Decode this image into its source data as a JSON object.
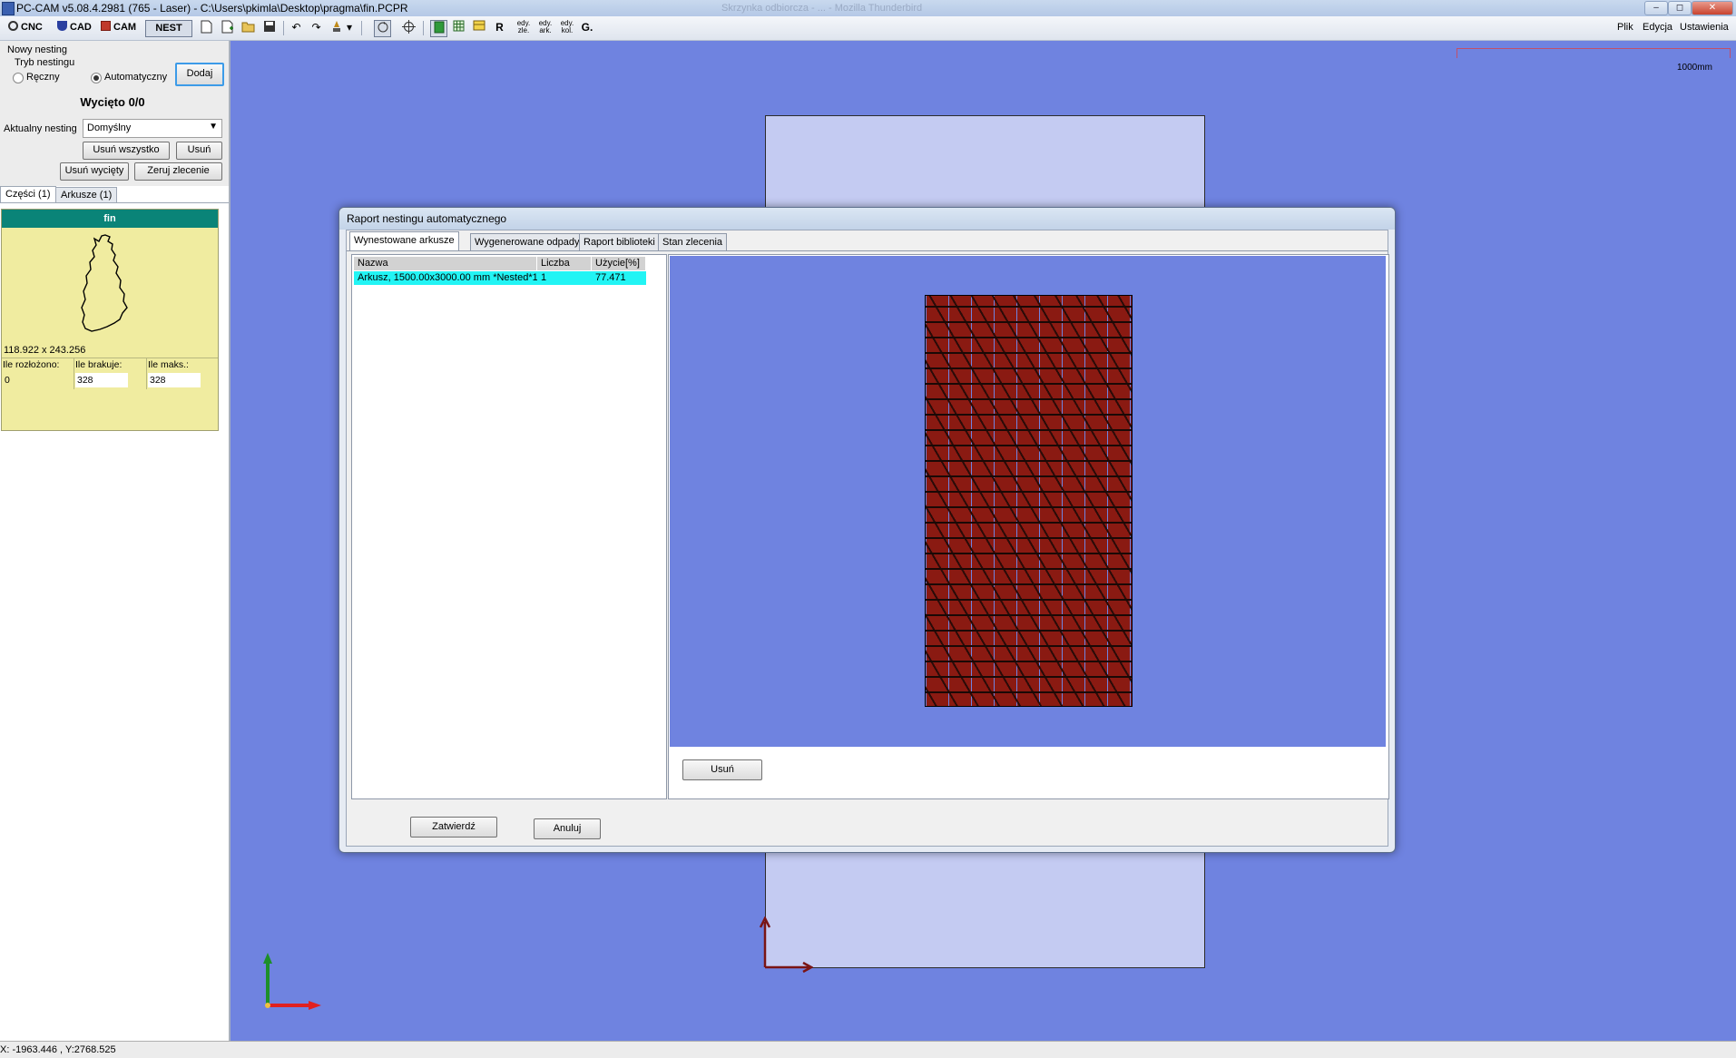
{
  "window": {
    "title": "PC-CAM v5.08.4.2981 (765 - Laser) - C:\\Users\\pkimla\\Desktop\\pragma\\fin.PCPR",
    "ghost_title": "Skrzynka odbiorcza - ... - Mozilla Thunderbird",
    "controls": {
      "minimize": "–",
      "maximize": "◻",
      "close": "✕"
    }
  },
  "toolbar": {
    "modes": [
      {
        "label": "CNC",
        "icon": "cnc-icon"
      },
      {
        "label": "CAD",
        "icon": "cad-icon"
      },
      {
        "label": "CAM",
        "icon": "cam-icon"
      },
      {
        "label": "NEST",
        "icon": "nest-icon",
        "active": true
      }
    ],
    "edit_labels": [
      "edy. zle.",
      "edy. ark.",
      "edy. kol."
    ],
    "r_label": "R",
    "g_label": "G.",
    "menu": [
      "Plik",
      "Edycja",
      "Ustawienia"
    ]
  },
  "left_panel": {
    "new_nesting_title": "Nowy nesting",
    "mode_label": "Tryb nestingu",
    "radio_manual": "Ręczny",
    "radio_auto": "Automatyczny",
    "radio_selected": "auto",
    "add_button": "Dodaj",
    "cut_status": "Wycięto 0/0",
    "current_nesting_label": "Aktualny nesting",
    "current_nesting_value": "Domyślny",
    "remove_all_button": "Usuń wszystko",
    "remove_button": "Usuń",
    "remove_cut_button": "Usuń wycięty",
    "reset_order_button": "Zeruj zlecenie",
    "tabs": [
      "Części (1)",
      "Arkusze (1)"
    ],
    "part": {
      "name": "fin",
      "dimensions": "118.922 x 243.256",
      "counts": [
        {
          "label": "Ile rozłożono:",
          "value": "0"
        },
        {
          "label": "Ile brakuje:",
          "value": "328"
        },
        {
          "label": "Ile maks.:",
          "value": "328"
        }
      ]
    }
  },
  "canvas": {
    "scale_label": "1000mm",
    "colors": {
      "background": "#6f83e0",
      "sheet": "#c4cbf2",
      "axis_x": "#e02020",
      "axis_y": "#1d8f2a",
      "origin": "#7a1414"
    }
  },
  "status_bar": {
    "coords": "X: -1963.446 , Y:2768.525"
  },
  "dialog": {
    "title": "Raport nestingu automatycznego",
    "tabs": [
      "Wynestowane arkusze",
      "Wygenerowane odpady",
      "Raport biblioteki",
      "Stan zlecenia"
    ],
    "active_tab": 0,
    "table": {
      "headers": [
        "Nazwa",
        "Liczba kopii",
        "Użycie[%]"
      ],
      "rows": [
        [
          "Arkusz, 1500.00x3000.00 mm *Nested*1",
          "1",
          "77.471"
        ]
      ]
    },
    "remove_button": "Usuń",
    "confirm_button": "Zatwierdź",
    "cancel_button": "Anuluj",
    "colors": {
      "part_fill": "#8a1a12",
      "highlight_row": "#22f4f4"
    }
  }
}
